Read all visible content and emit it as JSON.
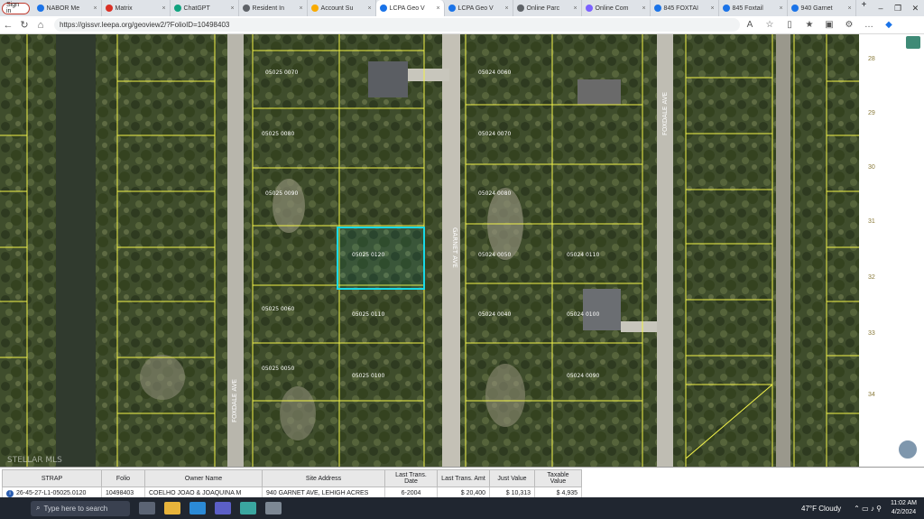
{
  "browser": {
    "signin_label": "Sign in",
    "tabs": [
      {
        "label": "NABOR Me",
        "color": "#1a73e8"
      },
      {
        "label": "Matrix",
        "color": "#d93025"
      },
      {
        "label": "ChatGPT",
        "color": "#10a37f"
      },
      {
        "label": "Resident In",
        "color": "#5f6368"
      },
      {
        "label": "Account Su",
        "color": "#f9ab00"
      },
      {
        "label": "LCPA Geo V",
        "color": "#1a73e8",
        "active": true
      },
      {
        "label": "LCPA Geo V",
        "color": "#1a73e8"
      },
      {
        "label": "Online Parc",
        "color": "#5f6368"
      },
      {
        "label": "Online Com",
        "color": "#7b61ff"
      },
      {
        "label": "845 FOXTAI",
        "color": "#1a73e8"
      },
      {
        "label": "845 Foxtail",
        "color": "#1a73e8"
      },
      {
        "label": "940 Garnet",
        "color": "#1a73e8"
      }
    ],
    "new_tab": "+",
    "window_controls": [
      "–",
      "❐",
      "✕"
    ],
    "url": "https://gissvr.leepa.org/geoview2/?FolioID=10498403"
  },
  "map": {
    "streets": [
      "GARNET AVE",
      "FOXDALE AVE",
      "FOXDALE AVE"
    ],
    "lot_labels": [
      "05025 0120",
      "05025 0110",
      "05025 0100",
      "05025 0090",
      "05025 0080",
      "05025 0070",
      "05025 0060",
      "05025 0050",
      "05024 0110",
      "05024 0100",
      "05024 0090",
      "05024 0080",
      "05024 0070",
      "05024 0060",
      "05024 0050",
      "05024 0040"
    ],
    "lot_numbers": [
      "28",
      "29",
      "30",
      "31",
      "32",
      "33",
      "34"
    ]
  },
  "attribute_table": {
    "headers": [
      "STRAP",
      "Folio",
      "Owner Name",
      "Site Address",
      "Last Trans. Date",
      "Last Trans. Amt",
      "Just Value",
      "Taxable Value"
    ],
    "row": [
      "26-45-27-L1-05025.0120",
      "10498403",
      "COELHO JOAO & JOAQUINA M",
      "940 GARNET AVE, LEHIGH ACRES",
      "6-2004",
      "$ 20,400",
      "$ 10,313",
      "$ 4,935"
    ]
  },
  "taskbar": {
    "search_placeholder": "Type here to search",
    "weather": "47°F  Cloudy",
    "time": "11:02 AM",
    "date": "4/2/2024"
  },
  "watermark": "STELLAR MLS"
}
